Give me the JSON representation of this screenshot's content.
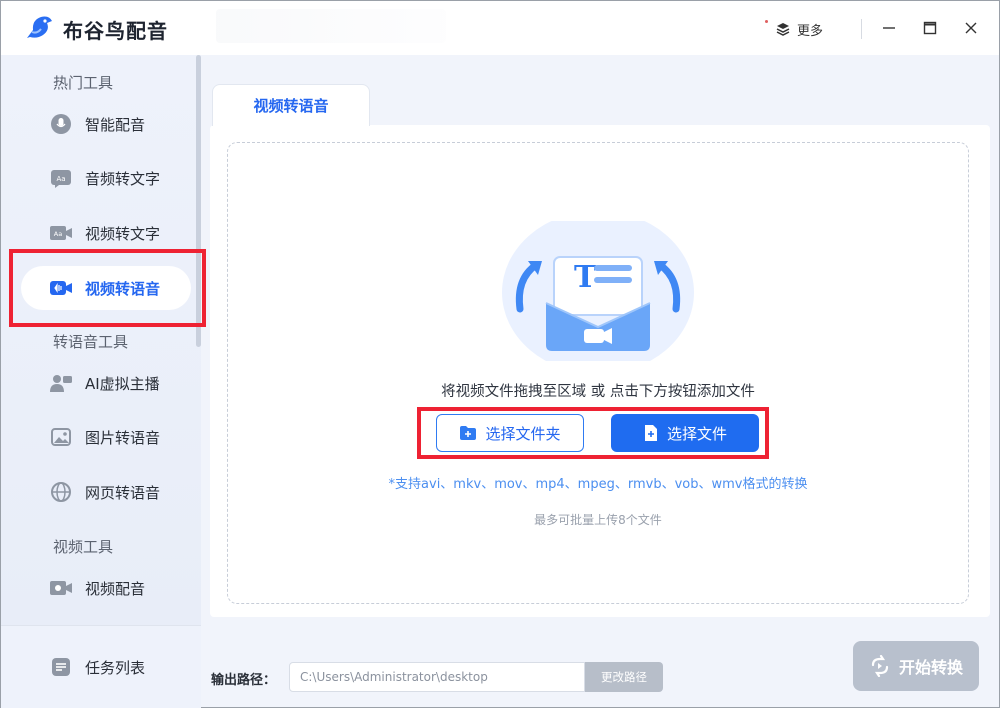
{
  "app": {
    "title": "布谷鸟配音"
  },
  "titlebar": {
    "more_label": "更多"
  },
  "sidebar": {
    "sections": [
      {
        "label": "热门工具"
      },
      {
        "label": "转语音工具"
      },
      {
        "label": "视频工具"
      }
    ],
    "items": [
      {
        "label": "智能配音",
        "icon": "mic-icon"
      },
      {
        "label": "音频转文字",
        "icon": "audio-text-icon"
      },
      {
        "label": "视频转文字",
        "icon": "video-text-icon"
      },
      {
        "label": "视频转语音",
        "icon": "video-camera-icon",
        "active": true
      },
      {
        "label": "AI虚拟主播",
        "icon": "anchor-icon"
      },
      {
        "label": "图片转语音",
        "icon": "image-icon"
      },
      {
        "label": "网页转语音",
        "icon": "globe-icon"
      },
      {
        "label": "视频配音",
        "icon": "video-dub-icon"
      }
    ],
    "task_list": "任务列表"
  },
  "main": {
    "tab_label": "视频转语音",
    "drop_hint": "将视频文件拖拽至区域 或 点击下方按钮添加文件",
    "select_folder": "选择文件夹",
    "select_file": "选择文件",
    "formats": "*支持avi、mkv、mov、mp4、mpeg、rmvb、vob、wmv格式的转换",
    "limit": "最多可批量上传8个文件"
  },
  "footer": {
    "output_label": "输出路径：",
    "output_path": "C:\\Users\\Administrator\\desktop",
    "change_path": "更改路径",
    "start": "开始转换"
  },
  "colors": {
    "accent": "#1f6cf0",
    "highlight_box": "#ee2233",
    "disabled": "#b8c0cd"
  }
}
